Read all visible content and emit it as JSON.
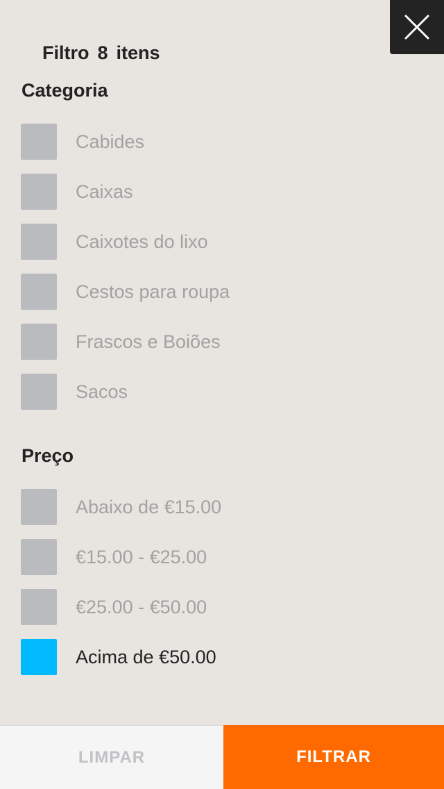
{
  "header": {
    "title": "Filtro",
    "count": "8",
    "count_suffix": "itens",
    "close_icon": "close-icon"
  },
  "categoria": {
    "title": "Categoria",
    "options": [
      {
        "label": "Cabides",
        "checked": false
      },
      {
        "label": "Caixas",
        "checked": false
      },
      {
        "label": "Caixotes do lixo",
        "checked": false
      },
      {
        "label": "Cestos para roupa",
        "checked": false
      },
      {
        "label": "Frascos e Boiões",
        "checked": false
      },
      {
        "label": "Sacos",
        "checked": false
      }
    ]
  },
  "preco": {
    "title": "Preço",
    "options": [
      {
        "label": "Abaixo de €15.00",
        "checked": false
      },
      {
        "label": "€15.00 - €25.00",
        "checked": false
      },
      {
        "label": "€25.00 - €50.00",
        "checked": false
      },
      {
        "label": "Acima de €50.00",
        "checked": true
      }
    ]
  },
  "footer": {
    "clear_label": "LIMPAR",
    "filter_label": "FILTRAR"
  },
  "colors": {
    "background": "#e8e5e0",
    "checkbox_unchecked": "#babbbf",
    "checkbox_checked": "#00b9ff",
    "filter_button": "#ff6a00",
    "close_button": "#232323"
  }
}
